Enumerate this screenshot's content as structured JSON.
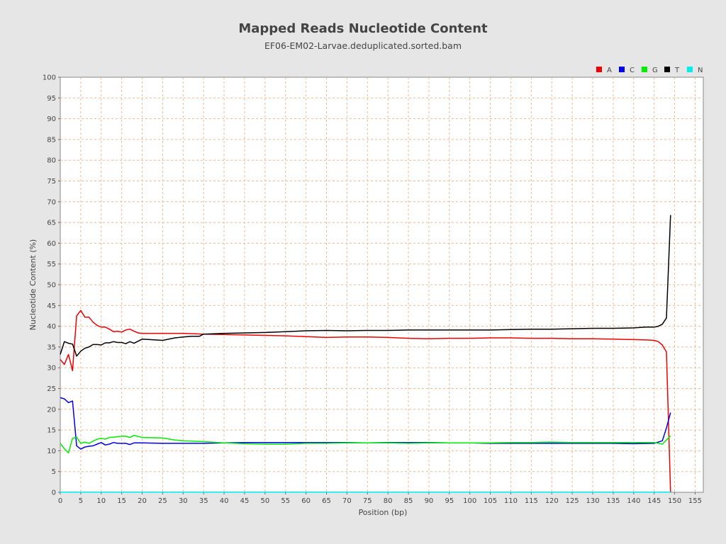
{
  "chart_data": {
    "type": "line",
    "title": "Mapped Reads Nucleotide Content",
    "subtitle": "EF06-EM02-Larvae.deduplicated.sorted.bam",
    "xlabel": "Position (bp)",
    "ylabel": "Nucleotide Content (%)",
    "xlim": [
      0,
      157
    ],
    "ylim": [
      0,
      100
    ],
    "x_ticks": [
      0,
      5,
      10,
      15,
      20,
      25,
      30,
      35,
      40,
      45,
      50,
      55,
      60,
      65,
      70,
      75,
      80,
      85,
      90,
      95,
      100,
      105,
      110,
      115,
      120,
      125,
      130,
      135,
      140,
      145,
      150,
      155
    ],
    "y_ticks": [
      0,
      5,
      10,
      15,
      20,
      25,
      30,
      35,
      40,
      45,
      50,
      55,
      60,
      65,
      70,
      75,
      80,
      85,
      90,
      95,
      100
    ],
    "grid": true,
    "legend_position": "top-right",
    "series": [
      {
        "name": "A",
        "color": "#ee0000",
        "points": [
          [
            0,
            32
          ],
          [
            1,
            30.8
          ],
          [
            2,
            33.2
          ],
          [
            3,
            29.3
          ],
          [
            4,
            42.5
          ],
          [
            5,
            43.8
          ],
          [
            6,
            42.2
          ],
          [
            7,
            42.2
          ],
          [
            8,
            41
          ],
          [
            9,
            40.2
          ],
          [
            10,
            39.8
          ],
          [
            11,
            39.8
          ],
          [
            12,
            39.3
          ],
          [
            13,
            38.7
          ],
          [
            14,
            38.8
          ],
          [
            15,
            38.6
          ],
          [
            16,
            39.1
          ],
          [
            17,
            39.3
          ],
          [
            18,
            38.8
          ],
          [
            19,
            38.4
          ],
          [
            20,
            38.3
          ],
          [
            25,
            38.3
          ],
          [
            30,
            38.3
          ],
          [
            35,
            38.1
          ],
          [
            40,
            38
          ],
          [
            45,
            37.9
          ],
          [
            50,
            37.8
          ],
          [
            55,
            37.7
          ],
          [
            60,
            37.5
          ],
          [
            65,
            37.3
          ],
          [
            70,
            37.4
          ],
          [
            75,
            37.4
          ],
          [
            80,
            37.3
          ],
          [
            85,
            37.1
          ],
          [
            90,
            37
          ],
          [
            95,
            37.1
          ],
          [
            100,
            37.1
          ],
          [
            105,
            37.2
          ],
          [
            110,
            37.2
          ],
          [
            115,
            37.1
          ],
          [
            120,
            37.1
          ],
          [
            125,
            37
          ],
          [
            130,
            37
          ],
          [
            135,
            36.9
          ],
          [
            140,
            36.8
          ],
          [
            143,
            36.7
          ],
          [
            145,
            36.6
          ],
          [
            146,
            36.3
          ],
          [
            147,
            35.5
          ],
          [
            148,
            33.8
          ],
          [
            149,
            0
          ]
        ]
      },
      {
        "name": "C",
        "color": "#0000ee",
        "points": [
          [
            0,
            22.8
          ],
          [
            1,
            22.5
          ],
          [
            2,
            21.6
          ],
          [
            3,
            22
          ],
          [
            4,
            11.2
          ],
          [
            5,
            10.4
          ],
          [
            6,
            10.9
          ],
          [
            7,
            11.1
          ],
          [
            8,
            11.2
          ],
          [
            9,
            11.6
          ],
          [
            10,
            12
          ],
          [
            11,
            11.4
          ],
          [
            12,
            11.6
          ],
          [
            13,
            12
          ],
          [
            14,
            11.8
          ],
          [
            15,
            11.8
          ],
          [
            16,
            11.8
          ],
          [
            17,
            11.5
          ],
          [
            18,
            11.9
          ],
          [
            20,
            11.9
          ],
          [
            25,
            11.8
          ],
          [
            30,
            11.8
          ],
          [
            35,
            11.8
          ],
          [
            40,
            11.9
          ],
          [
            45,
            12
          ],
          [
            50,
            12
          ],
          [
            55,
            12
          ],
          [
            60,
            12
          ],
          [
            65,
            12
          ],
          [
            70,
            12
          ],
          [
            75,
            11.9
          ],
          [
            80,
            12
          ],
          [
            85,
            12
          ],
          [
            90,
            12
          ],
          [
            95,
            11.9
          ],
          [
            100,
            11.9
          ],
          [
            105,
            11.8
          ],
          [
            110,
            11.8
          ],
          [
            115,
            11.8
          ],
          [
            120,
            11.8
          ],
          [
            125,
            11.8
          ],
          [
            130,
            11.8
          ],
          [
            135,
            11.8
          ],
          [
            140,
            11.7
          ],
          [
            145,
            11.8
          ],
          [
            147,
            12.4
          ],
          [
            148,
            15.5
          ],
          [
            149,
            19.2
          ]
        ]
      },
      {
        "name": "G",
        "color": "#00ee00",
        "points": [
          [
            0,
            11.8
          ],
          [
            1,
            10.5
          ],
          [
            2,
            9.5
          ],
          [
            3,
            13
          ],
          [
            4,
            13.3
          ],
          [
            5,
            11.8
          ],
          [
            6,
            12.1
          ],
          [
            7,
            11.8
          ],
          [
            8,
            12.3
          ],
          [
            9,
            12.8
          ],
          [
            10,
            13
          ],
          [
            11,
            12.8
          ],
          [
            12,
            13.2
          ],
          [
            13,
            13.3
          ],
          [
            14,
            13.4
          ],
          [
            15,
            13.5
          ],
          [
            16,
            13.5
          ],
          [
            17,
            13.2
          ],
          [
            18,
            13.7
          ],
          [
            20,
            13.2
          ],
          [
            25,
            13.1
          ],
          [
            28,
            12.6
          ],
          [
            30,
            12.4
          ],
          [
            35,
            12.2
          ],
          [
            40,
            11.9
          ],
          [
            45,
            11.7
          ],
          [
            50,
            11.6
          ],
          [
            55,
            11.6
          ],
          [
            60,
            11.8
          ],
          [
            65,
            11.8
          ],
          [
            70,
            11.9
          ],
          [
            75,
            11.9
          ],
          [
            80,
            11.9
          ],
          [
            85,
            11.8
          ],
          [
            90,
            11.9
          ],
          [
            95,
            11.9
          ],
          [
            100,
            11.9
          ],
          [
            105,
            11.9
          ],
          [
            110,
            12
          ],
          [
            115,
            12
          ],
          [
            120,
            12.1
          ],
          [
            125,
            12
          ],
          [
            130,
            12
          ],
          [
            135,
            12
          ],
          [
            140,
            12
          ],
          [
            145,
            12
          ],
          [
            147,
            11.6
          ],
          [
            148,
            12.6
          ],
          [
            149,
            13.6
          ]
        ]
      },
      {
        "name": "T",
        "color": "#000000",
        "points": [
          [
            0,
            33.2
          ],
          [
            1,
            36.3
          ],
          [
            2,
            35.9
          ],
          [
            3,
            35.7
          ],
          [
            4,
            32.8
          ],
          [
            5,
            34
          ],
          [
            6,
            34.7
          ],
          [
            7,
            35
          ],
          [
            8,
            35.6
          ],
          [
            9,
            35.6
          ],
          [
            10,
            35.5
          ],
          [
            11,
            36
          ],
          [
            12,
            36
          ],
          [
            13,
            36.3
          ],
          [
            14,
            36.1
          ],
          [
            15,
            36.1
          ],
          [
            16,
            35.8
          ],
          [
            17,
            36.3
          ],
          [
            18,
            35.9
          ],
          [
            20,
            36.9
          ],
          [
            25,
            36.6
          ],
          [
            28,
            37.2
          ],
          [
            30,
            37.4
          ],
          [
            32,
            37.6
          ],
          [
            34,
            37.6
          ],
          [
            35,
            38.1
          ],
          [
            40,
            38.3
          ],
          [
            45,
            38.4
          ],
          [
            50,
            38.5
          ],
          [
            55,
            38.7
          ],
          [
            60,
            38.9
          ],
          [
            65,
            39
          ],
          [
            70,
            38.9
          ],
          [
            75,
            39
          ],
          [
            80,
            39
          ],
          [
            85,
            39.1
          ],
          [
            90,
            39.1
          ],
          [
            95,
            39.1
          ],
          [
            100,
            39.1
          ],
          [
            105,
            39.1
          ],
          [
            110,
            39.2
          ],
          [
            115,
            39.3
          ],
          [
            120,
            39.3
          ],
          [
            125,
            39.4
          ],
          [
            130,
            39.5
          ],
          [
            135,
            39.5
          ],
          [
            140,
            39.6
          ],
          [
            143,
            39.8
          ],
          [
            145,
            39.8
          ],
          [
            146,
            40
          ],
          [
            147,
            40.5
          ],
          [
            148,
            42
          ],
          [
            149,
            66.8
          ]
        ]
      },
      {
        "name": "N",
        "color": "#00eeee",
        "points": [
          [
            0,
            0.05
          ],
          [
            149,
            0.05
          ]
        ]
      }
    ]
  }
}
